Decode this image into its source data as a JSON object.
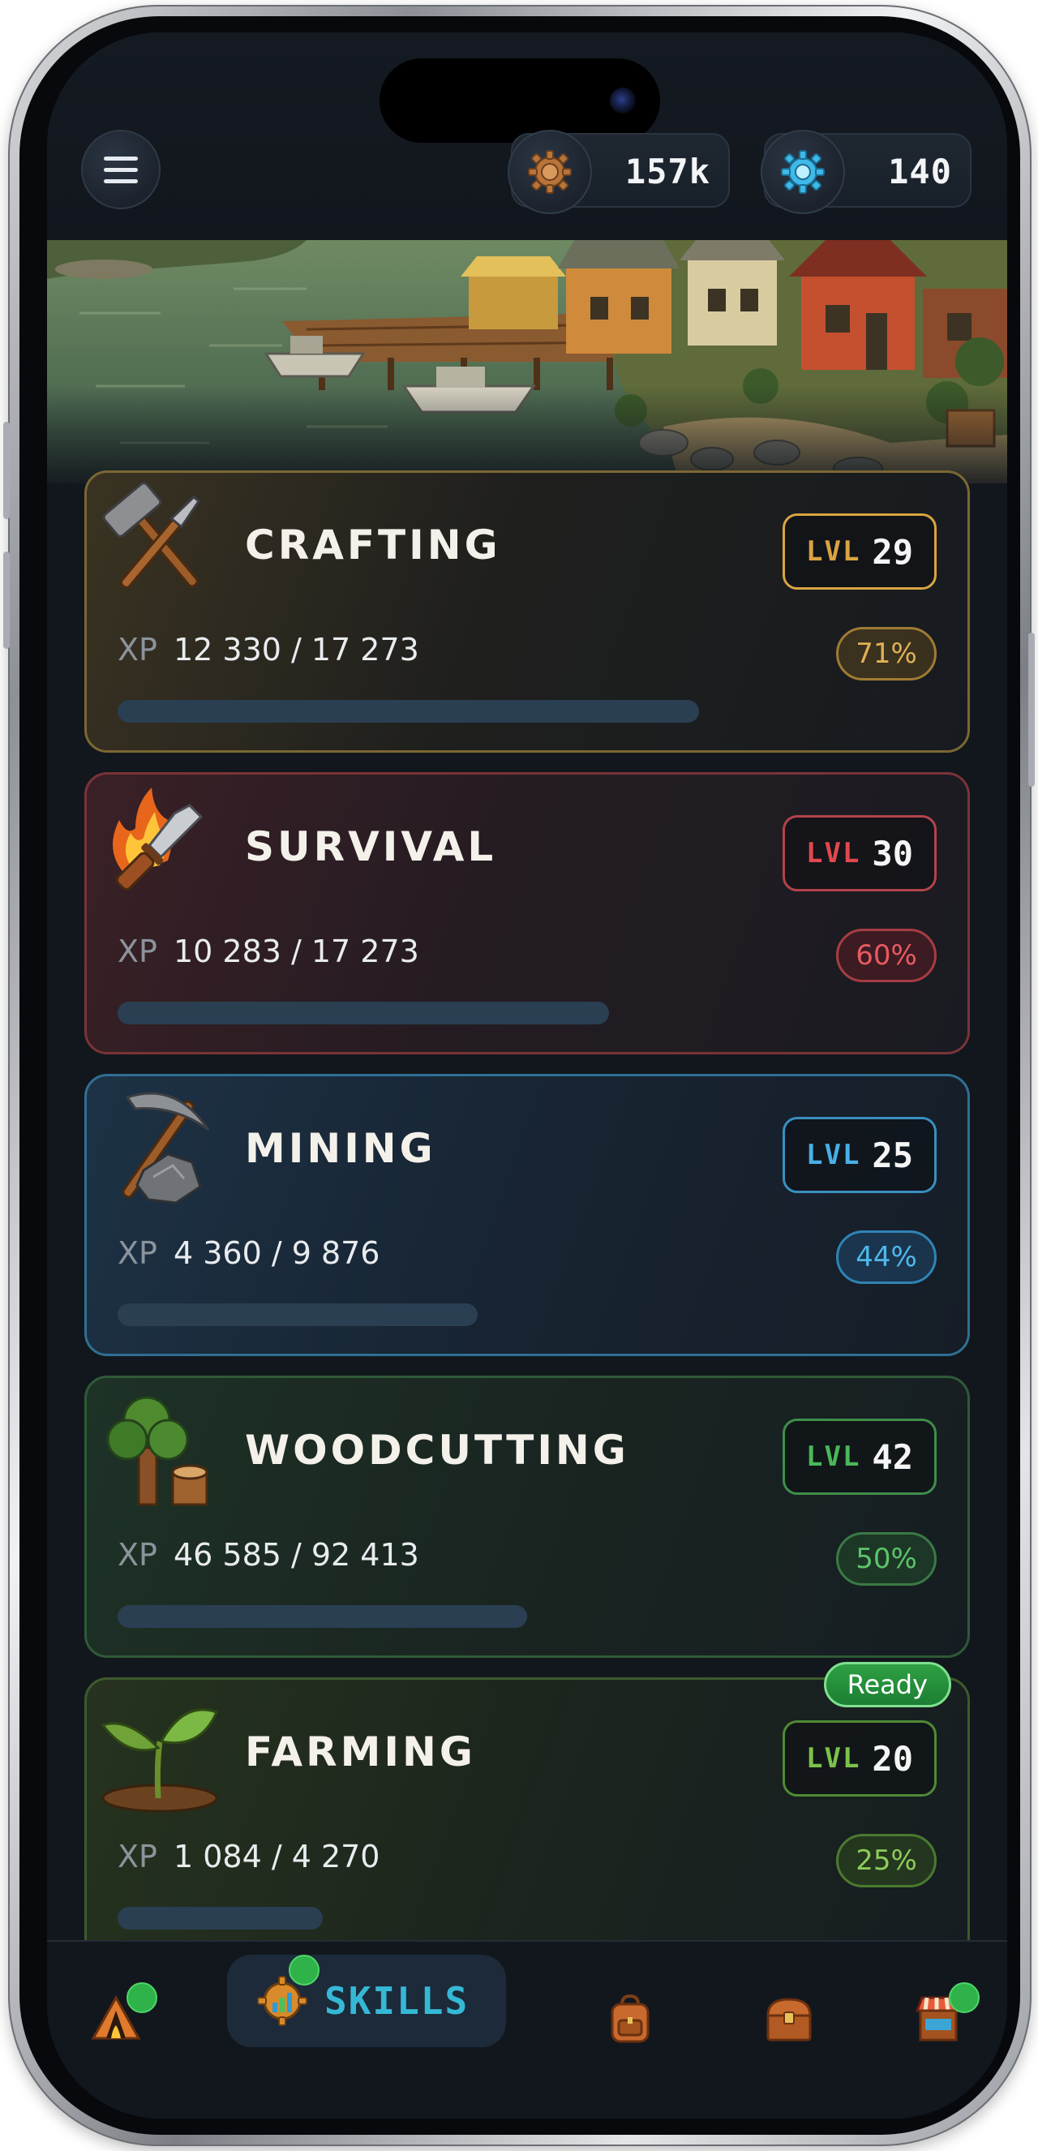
{
  "topbar": {
    "currencies": [
      {
        "icon": "bronze-gear-coin-icon",
        "value": "157k"
      },
      {
        "icon": "blue-gear-gem-icon",
        "value": "140"
      }
    ]
  },
  "hero": {
    "image": "fishing-village-harbor-illustration"
  },
  "skills": [
    {
      "name": "CRAFTING",
      "icon": "crossed-hammer-chisel-icon",
      "lvl_label": "LVL",
      "level": "29",
      "xp_label": "XP",
      "xp": "12 330 / 17 273",
      "percent": "71%",
      "progress": 0.71,
      "accent": "#d9a441",
      "ready": false
    },
    {
      "name": "SURVIVAL",
      "icon": "flaming-knife-icon",
      "lvl_label": "LVL",
      "level": "30",
      "xp_label": "XP",
      "xp": "10 283 / 17 273",
      "percent": "60%",
      "progress": 0.6,
      "accent": "#d9444a",
      "ready": false
    },
    {
      "name": "MINING",
      "icon": "pickaxe-rock-icon",
      "lvl_label": "LVL",
      "level": "25",
      "xp_label": "XP",
      "xp": "4 360 / 9 876",
      "percent": "44%",
      "progress": 0.44,
      "accent": "#3fa6dc",
      "ready": false
    },
    {
      "name": "WOODCUTTING",
      "icon": "tree-stump-icon",
      "lvl_label": "LVL",
      "level": "42",
      "xp_label": "XP",
      "xp": "46 585 / 92 413",
      "percent": "50%",
      "progress": 0.5,
      "accent": "#4bb75a",
      "ready": false
    },
    {
      "name": "FARMING",
      "icon": "sprout-soil-icon",
      "lvl_label": "LVL",
      "level": "20",
      "xp_label": "XP",
      "xp": "1 084 / 4 270",
      "percent": "25%",
      "progress": 0.25,
      "accent": "#7cc24a",
      "ready": true,
      "ready_label": "Ready"
    }
  ],
  "nav": {
    "items": [
      {
        "id": "camp",
        "icon": "campfire-tent-icon",
        "badge": true
      },
      {
        "id": "skills",
        "icon": "gear-chart-icon",
        "label": "SKILLS",
        "active": true,
        "badge": true
      },
      {
        "id": "inventory",
        "icon": "backpack-icon",
        "badge": false
      },
      {
        "id": "chest",
        "icon": "treasure-chest-icon",
        "badge": false
      },
      {
        "id": "shop",
        "icon": "market-stall-icon",
        "badge": true
      }
    ]
  },
  "colors": {
    "background": "#12171d",
    "crafting": "#d9a441",
    "survival": "#d9444a",
    "mining": "#3fa6dc",
    "woodcutting": "#4bb75a",
    "farming": "#7cc24a",
    "ready_green": "#2ea043",
    "skills_accent": "#35b8d6"
  }
}
